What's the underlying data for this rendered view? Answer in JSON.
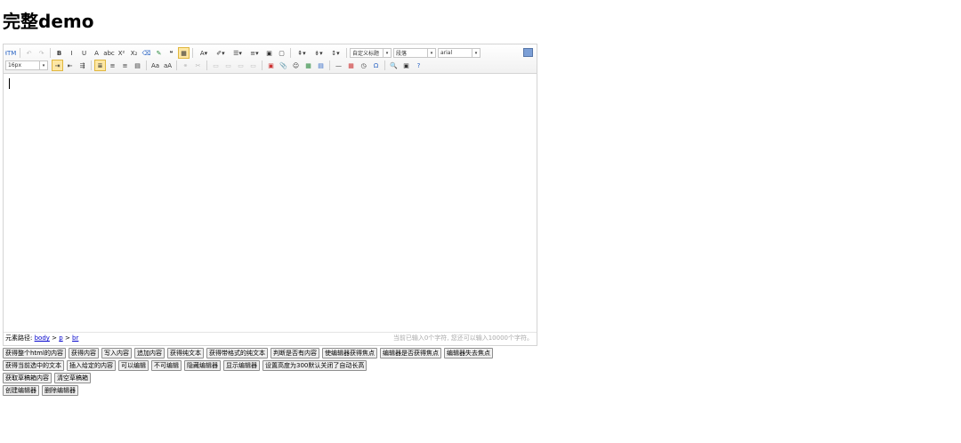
{
  "page": {
    "title": "完整demo"
  },
  "toolbar": {
    "row1": [
      {
        "name": "source-button",
        "glyph": "HTML",
        "cls": "blue"
      },
      {
        "sep": true
      },
      {
        "name": "undo-button",
        "glyph": "↶",
        "cls": "dis"
      },
      {
        "name": "redo-button",
        "glyph": "↷",
        "cls": "dis"
      },
      {
        "sep": true
      },
      {
        "name": "bold-button",
        "glyph": "B",
        "cls": "bold"
      },
      {
        "name": "italic-button",
        "glyph": "I"
      },
      {
        "name": "underline-button",
        "glyph": "U"
      },
      {
        "name": "fontborder-button",
        "glyph": "A"
      },
      {
        "name": "strikethrough-button",
        "glyph": "abc"
      },
      {
        "name": "superscript-button",
        "glyph": "X²"
      },
      {
        "name": "subscript-button",
        "glyph": "X₂"
      },
      {
        "name": "removeformat-button",
        "glyph": "⌫",
        "cls": "blue"
      },
      {
        "name": "formatmatch-button",
        "glyph": "✎",
        "cls": "green"
      },
      {
        "name": "blockquote-button",
        "glyph": "❝"
      },
      {
        "name": "pasteplain-button",
        "glyph": "▦",
        "cls": "active"
      },
      {
        "sep": true
      },
      {
        "name": "forecolor-button",
        "glyph": "A▾",
        "wide": true
      },
      {
        "name": "backcolor-button",
        "glyph": "✐▾",
        "wide": true
      },
      {
        "name": "insertorderedlist-button",
        "glyph": "☰▾",
        "wide": true
      },
      {
        "name": "insertunorderedlist-button",
        "glyph": "≡▾",
        "wide": true
      },
      {
        "name": "selectall-button",
        "glyph": "▣"
      },
      {
        "name": "cleardoc-button",
        "glyph": "▢"
      },
      {
        "sep": true
      },
      {
        "name": "rowspacingtop-button",
        "glyph": "⇞▾",
        "wide": true
      },
      {
        "name": "rowspacingbottom-button",
        "glyph": "⇟▾",
        "wide": true
      },
      {
        "name": "lineheight-button",
        "glyph": "↕▾",
        "wide": true
      },
      {
        "sep": true
      }
    ],
    "row2": [
      {
        "name": "directionalityltr-button",
        "glyph": "⇥",
        "cls": "active"
      },
      {
        "name": "directionalityrtl-button",
        "glyph": "⇤"
      },
      {
        "name": "indent-button",
        "glyph": "⇶"
      },
      {
        "sep": true
      },
      {
        "name": "justifyleft-button",
        "glyph": "≣",
        "cls": "active"
      },
      {
        "name": "justifycenter-button",
        "glyph": "≡"
      },
      {
        "name": "justifyright-button",
        "glyph": "≡"
      },
      {
        "name": "justifyjustify-button",
        "glyph": "▤"
      },
      {
        "sep": true
      },
      {
        "name": "touppercase-button",
        "glyph": "Aa"
      },
      {
        "name": "tolowercase-button",
        "glyph": "aA"
      },
      {
        "sep": true
      },
      {
        "name": "link-button",
        "glyph": "⚭",
        "cls": "dis"
      },
      {
        "name": "unlink-button",
        "glyph": "✂",
        "cls": "dis"
      },
      {
        "sep": true
      },
      {
        "name": "imagenone-button",
        "glyph": "▭",
        "cls": "dis"
      },
      {
        "name": "imageleft-button",
        "glyph": "▭",
        "cls": "dis"
      },
      {
        "name": "imageright-button",
        "glyph": "▭",
        "cls": "dis"
      },
      {
        "name": "imagecenter-button",
        "glyph": "▭",
        "cls": "dis"
      },
      {
        "sep": true
      },
      {
        "name": "insertimage-button",
        "glyph": "▣",
        "cls": "red"
      },
      {
        "name": "attachment-button",
        "glyph": "📎"
      },
      {
        "name": "emotion-button",
        "glyph": "☺"
      },
      {
        "name": "map-button",
        "glyph": "▦",
        "cls": "green"
      },
      {
        "name": "template-button",
        "glyph": "▤",
        "cls": "blue"
      },
      {
        "sep": true
      },
      {
        "name": "horizontal-button",
        "glyph": "—"
      },
      {
        "name": "date-button",
        "glyph": "▦",
        "cls": "red"
      },
      {
        "name": "time-button",
        "glyph": "◷"
      },
      {
        "name": "spechars-button",
        "glyph": "Ω",
        "cls": "blue"
      },
      {
        "sep": true
      },
      {
        "name": "searchreplace-button",
        "glyph": "🔍"
      },
      {
        "name": "drafts-button",
        "glyph": "▣"
      },
      {
        "name": "help-button",
        "glyph": "?",
        "cls": "blue"
      }
    ],
    "paragraph_format": "自定义标题",
    "paragraph": "段落",
    "font_family": "arial",
    "font_size": "16px"
  },
  "statusbar": {
    "path_label": "元素路径:",
    "path_body": "body",
    "path_p": "p",
    "path_br": "br",
    "path_sep": ">",
    "word_count": "当前已输入0个字符, 您还可以输入10000个字符。"
  },
  "buttons": {
    "row1": [
      "获得整个html的内容",
      "获得内容",
      "写入内容",
      "追加内容",
      "获得纯文本",
      "获得带格式的纯文本",
      "判断是否有内容",
      "使编辑器获得焦点",
      "编辑器是否获得焦点",
      "编辑器失去焦点"
    ],
    "row2": [
      "获得当前选中的文本",
      "插入给定的内容",
      "可以编辑",
      "不可编辑",
      "隐藏编辑器",
      "显示编辑器",
      "设置高度为300默认关闭了自动长高"
    ],
    "row3": [
      "获取草稿箱内容",
      "清空草稿箱"
    ],
    "row4": [
      "创建编辑器",
      "删除编辑器"
    ]
  }
}
